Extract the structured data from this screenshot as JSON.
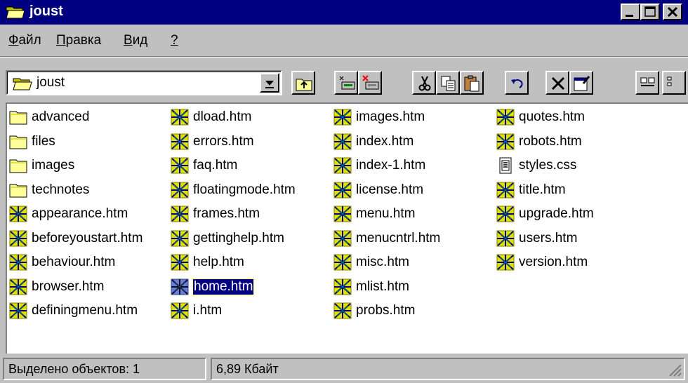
{
  "window": {
    "title": "joust",
    "controls": [
      "minimize-icon",
      "maximize-icon",
      "close-icon"
    ]
  },
  "menu": {
    "items": [
      {
        "label": "Файл",
        "accel": "Ф",
        "rest": "айл"
      },
      {
        "label": "Правка",
        "accel": "П",
        "rest": "равка"
      },
      {
        "label": "Вид",
        "accel": "В",
        "rest": "ид"
      },
      {
        "label": "?",
        "accel": "?",
        "rest": ""
      }
    ]
  },
  "toolbar": {
    "address_value": "joust",
    "buttons": [
      "up-folder-icon",
      "map-network-drive-icon",
      "disconnect-drive-icon",
      "cut-icon",
      "copy-icon",
      "paste-icon",
      "undo-icon",
      "delete-icon",
      "properties-icon",
      "large-icons-view-icon",
      "small-icons-view-icon"
    ]
  },
  "files": {
    "col1": [
      {
        "name": "advanced",
        "type": "folder"
      },
      {
        "name": "files",
        "type": "folder"
      },
      {
        "name": "images",
        "type": "folder"
      },
      {
        "name": "technotes",
        "type": "folder"
      },
      {
        "name": "appearance.htm",
        "type": "htm"
      },
      {
        "name": "beforeyoustart.htm",
        "type": "htm"
      },
      {
        "name": "behaviour.htm",
        "type": "htm"
      },
      {
        "name": "browser.htm",
        "type": "htm"
      },
      {
        "name": "definingmenu.htm",
        "type": "htm"
      }
    ],
    "col2": [
      {
        "name": "dload.htm",
        "type": "htm"
      },
      {
        "name": "errors.htm",
        "type": "htm"
      },
      {
        "name": "faq.htm",
        "type": "htm"
      },
      {
        "name": "floatingmode.htm",
        "type": "htm"
      },
      {
        "name": "frames.htm",
        "type": "htm"
      },
      {
        "name": "gettinghelp.htm",
        "type": "htm"
      },
      {
        "name": "help.htm",
        "type": "htm"
      },
      {
        "name": "home.htm",
        "type": "htm",
        "selected": true
      },
      {
        "name": "i.htm",
        "type": "htm"
      }
    ],
    "col3": [
      {
        "name": "images.htm",
        "type": "htm"
      },
      {
        "name": "index.htm",
        "type": "htm"
      },
      {
        "name": "index-1.htm",
        "type": "htm"
      },
      {
        "name": "license.htm",
        "type": "htm"
      },
      {
        "name": "menu.htm",
        "type": "htm"
      },
      {
        "name": "menucntrl.htm",
        "type": "htm"
      },
      {
        "name": "misc.htm",
        "type": "htm"
      },
      {
        "name": "mlist.htm",
        "type": "htm"
      },
      {
        "name": "probs.htm",
        "type": "htm"
      }
    ],
    "col4": [
      {
        "name": "quotes.htm",
        "type": "htm"
      },
      {
        "name": "robots.htm",
        "type": "htm"
      },
      {
        "name": "styles.css",
        "type": "css"
      },
      {
        "name": "title.htm",
        "type": "htm"
      },
      {
        "name": "upgrade.htm",
        "type": "htm"
      },
      {
        "name": "users.htm",
        "type": "htm"
      },
      {
        "name": "version.htm",
        "type": "htm"
      }
    ]
  },
  "status": {
    "selected_count": "Выделено объектов: 1",
    "size": "6,89 Кбайт"
  },
  "colors": {
    "titlebar": "#000080",
    "face": "#c0c0c0",
    "selection": "#000080"
  }
}
